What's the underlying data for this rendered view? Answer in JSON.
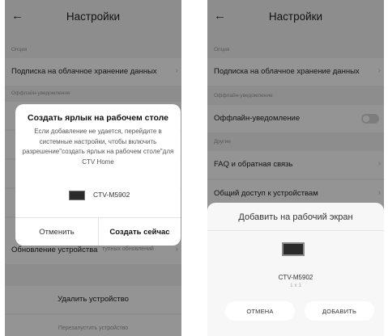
{
  "left": {
    "header": {
      "back_icon": "←",
      "title": "Настройки"
    },
    "section_option": "Опция",
    "cloud_row_label": "Подписка на облачное хранение данных",
    "chevron": "›",
    "section_offline": "Оффлайн-уведомление",
    "update_row_label": "Обновление устройства",
    "update_row_sub": "тупных обновлений",
    "delete_label": "Удалить устройство",
    "restart_label": "Перезапустить устройство",
    "dialog": {
      "title": "Создать ярлык на рабочем столе",
      "body": "Если добавление не удается, перейдите в системные настройки, чтобы включить разрешение\"создать ярлык на рабочем столе\"для CTV Home",
      "device_name": "CTV-M5902",
      "cancel_label": "Отменить",
      "confirm_label": "Создать сейчас"
    }
  },
  "right": {
    "header": {
      "back_icon": "←",
      "title": "Настройки"
    },
    "section_option": "Опция",
    "cloud_row_label": "Подписка на облачное хранение данных",
    "chevron": "›",
    "section_offline": "Оффлайн-уведомление",
    "offline_row_label": "Оффлайн-уведомление",
    "section_other": "Другие",
    "faq_label": "FAQ и обратная связь",
    "share_label": "Общий доступ к устройствам",
    "sheet": {
      "title": "Добавить на рабочий экран",
      "device_name": "CTV-M5902",
      "device_size": "1 x 1",
      "cancel_label": "ОТМЕНА",
      "add_label": "ДОБАВИТЬ"
    }
  }
}
